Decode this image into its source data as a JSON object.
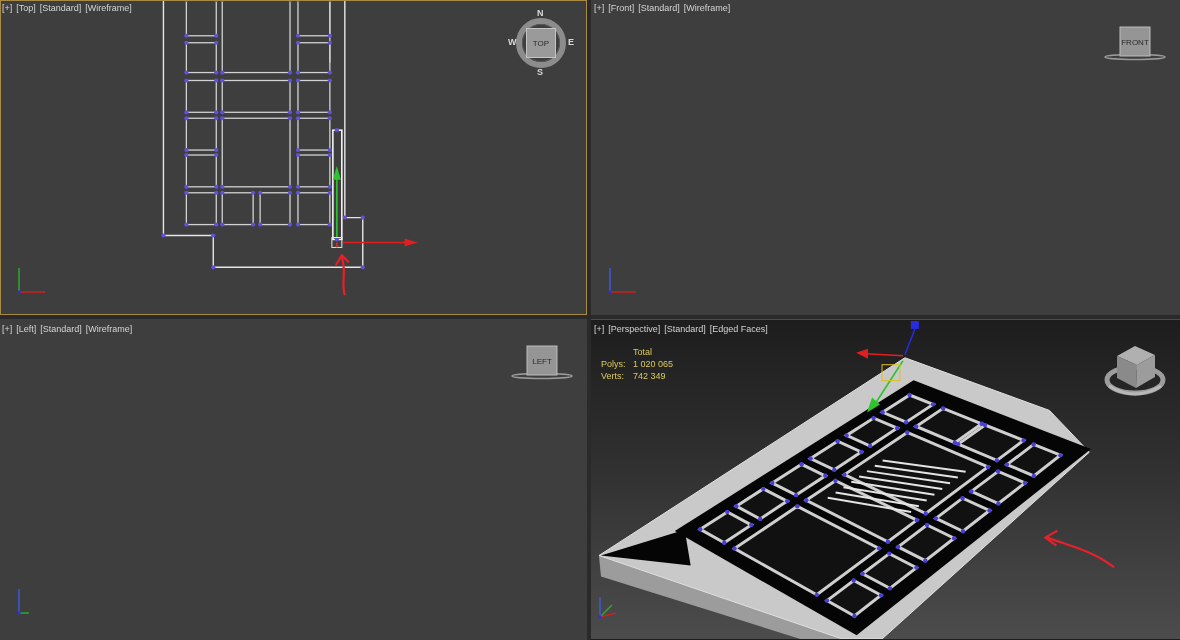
{
  "viewports": [
    {
      "kind": "top",
      "active": true,
      "menus": [
        "[+]",
        "[Top]",
        "[Standard]",
        "[Wireframe]"
      ],
      "viewcube": {
        "kind": "compass",
        "face": "TOP",
        "compass": {
          "north": "N",
          "east": "E",
          "south": "S",
          "west": "W"
        }
      }
    },
    {
      "kind": "front",
      "active": false,
      "menus": [
        "[+]",
        "[Front]",
        "[Standard]",
        "[Wireframe]"
      ],
      "viewcube": {
        "kind": "flat",
        "face": "FRONT"
      }
    },
    {
      "kind": "left",
      "active": false,
      "menus": [
        "[+]",
        "[Left]",
        "[Standard]",
        "[Wireframe]"
      ],
      "viewcube": {
        "kind": "flat",
        "face": "LEFT"
      }
    },
    {
      "kind": "perspective",
      "active": false,
      "menus": [
        "[+]",
        "[Perspective]",
        "[Standard]",
        "[Edged Faces]"
      ],
      "viewcube": {
        "kind": "cube"
      },
      "stats": {
        "heading": "Total",
        "rows": [
          {
            "label": "Polys:",
            "value": "1 020 065"
          },
          {
            "label": "Verts:",
            "value": "742 349"
          }
        ]
      }
    }
  ]
}
